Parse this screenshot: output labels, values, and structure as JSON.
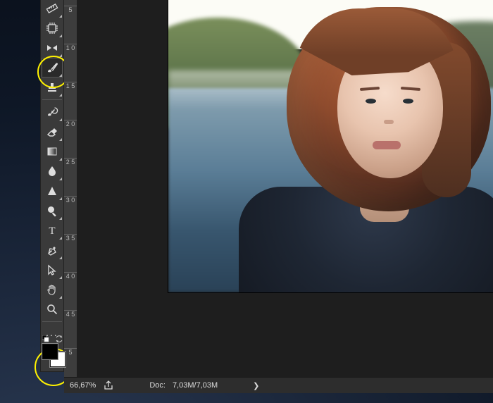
{
  "tools": {
    "ruler": {
      "name": "ruler-tool"
    },
    "artboard": {
      "name": "artboard-tool"
    },
    "slice": {
      "name": "slice-tool"
    },
    "brush": {
      "name": "brush-tool"
    },
    "stamp": {
      "name": "clone-stamp-tool"
    },
    "historybrush": {
      "name": "history-brush-tool"
    },
    "eraser": {
      "name": "eraser-tool"
    },
    "gradient": {
      "name": "gradient-tool"
    },
    "blur": {
      "name": "blur-tool"
    },
    "dodge": {
      "name": "dodge-tool"
    },
    "zoom": {
      "name": "zoom-tool"
    },
    "type": {
      "name": "type-tool"
    },
    "pen": {
      "name": "pen-tool"
    },
    "pathsel": {
      "name": "path-selection-tool"
    },
    "hand": {
      "name": "hand-tool"
    },
    "magnify": {
      "name": "magnify-tool"
    },
    "more": {
      "label": "..."
    }
  },
  "swatches": {
    "fg_color": "#000000",
    "bg_color": "#ffffff"
  },
  "ruler_v_ticks": [
    "5",
    "1 0",
    "1 5",
    "2 0",
    "2 5",
    "3 0",
    "3 5",
    "4 0",
    "4 5",
    "5"
  ],
  "status": {
    "zoom": "66,67%",
    "doc_label": "Doc:",
    "doc_sizes": "7,03M/7,03M",
    "expand": "❯"
  }
}
